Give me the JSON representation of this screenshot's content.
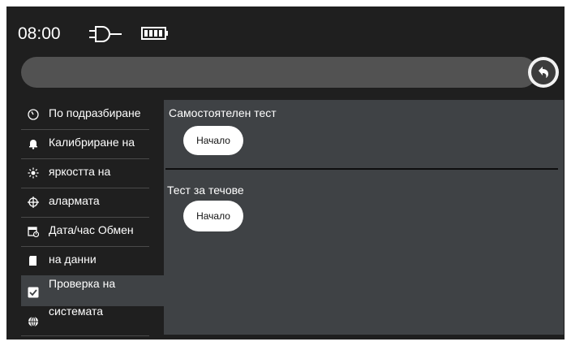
{
  "status_bar": {
    "time": "08:00",
    "power_icon": "plug-icon",
    "battery_icon": "battery-full-icon"
  },
  "toolbar": {
    "back_icon": "back-arrow-icon"
  },
  "sidebar": {
    "items": [
      {
        "label": "По подразбиране",
        "icon": "gauge-icon"
      },
      {
        "label": "Калибриране на",
        "icon": "bell-icon"
      },
      {
        "label": "яркостта на",
        "icon": "brightness-icon"
      },
      {
        "label": "алармата",
        "icon": "crosshair-icon"
      },
      {
        "label": "Дата/час Обмен",
        "icon": "calendar-clock-icon"
      },
      {
        "label": "на данни",
        "icon": "sd-card-icon"
      },
      {
        "label": "Проверка на",
        "icon": "checkbox-icon"
      },
      {
        "label": "системата",
        "icon": "globe-icon"
      }
    ]
  },
  "main": {
    "self_test": {
      "title": "Самостоятелен тест",
      "button_label": "Начало"
    },
    "leak_test": {
      "title": "Тест за течове",
      "button_label": "Начало"
    }
  },
  "colors": {
    "screen_bg": "#1f1f1f",
    "panel_bg": "#3f4245",
    "bar_bg": "#525252",
    "text": "#ffffff"
  }
}
